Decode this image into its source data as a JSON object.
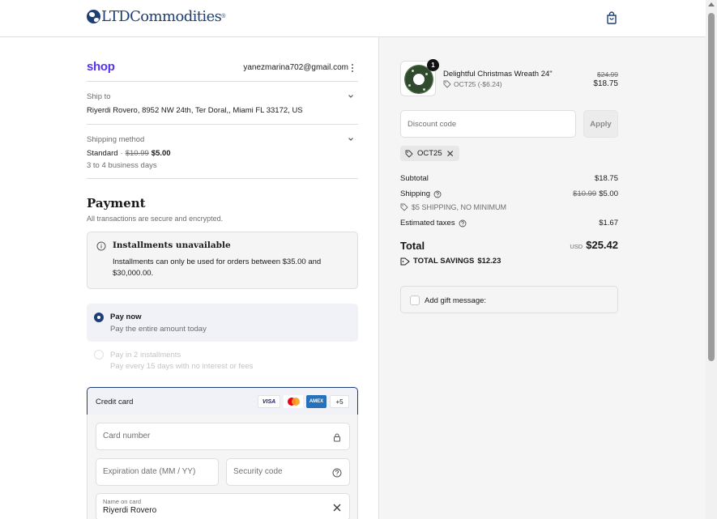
{
  "header": {
    "brand": "LTDCommodities",
    "brand_mark": "®",
    "cart_icon": "shopping-bag-icon"
  },
  "account": {
    "provider": "shop",
    "email": "yanezmarina702@gmail.com",
    "menu_icon": "more-vertical-icon"
  },
  "review": {
    "ship_to_label": "Ship to",
    "ship_to_value": "Riyerdi Rovero, 8952 NW 24th, Ter Doral,, Miami FL 33172, US",
    "shipping_method_label": "Shipping method",
    "shipping_method_name": "Standard",
    "shipping_separator": "·",
    "shipping_original": "$10.99",
    "shipping_price": "$5.00",
    "shipping_eta": "3 to 4 business days"
  },
  "payment": {
    "title": "Payment",
    "subtitle": "All transactions are secure and encrypted.",
    "installments_title": "Installments unavailable",
    "installments_text": "Installments can only be used for orders between $35.00 and $30,000.00.",
    "options": [
      {
        "title": "Pay now",
        "subtitle": "Pay the entire amount today",
        "selected": true
      },
      {
        "title": "Pay in 2 installments",
        "subtitle": "Pay every 15 days with no interest or fees",
        "selected": false
      }
    ],
    "credit_card_label": "Credit card",
    "card_brands": [
      "VISA",
      "AMEX",
      "+5"
    ],
    "card_number_placeholder": "Card number",
    "expiration_placeholder": "Expiration date (MM / YY)",
    "security_placeholder": "Security code",
    "name_label": "Name on card",
    "name_value": "Riyerdi Rovero"
  },
  "summary": {
    "product_name": "Delightful Christmas Wreath 24\"",
    "product_qty": "1",
    "product_discount": "OCT25 (-$6.24)",
    "product_original": "$24.99",
    "product_price": "$18.75",
    "discount_placeholder": "Discount code",
    "apply_label": "Apply",
    "applied_code": "OCT25",
    "remove_code": "✕",
    "subtotal_label": "Subtotal",
    "subtotal_value": "$18.75",
    "shipping_label": "Shipping",
    "shipping_original": "$10.99",
    "shipping_value": "$5.00",
    "shipping_promo": "$5 SHIPPING, NO MINIMUM",
    "taxes_label": "Estimated taxes",
    "taxes_value": "$1.67",
    "total_label": "Total",
    "total_currency": "USD",
    "total_value": "$25.42",
    "savings_label": "TOTAL SAVINGS",
    "savings_value": "$12.23",
    "gift_label": "Add gift message:"
  },
  "colors": {
    "brand_navy": "#1d3f73",
    "shop_purple": "#5433eb",
    "panel_gray": "#f5f5f5"
  }
}
